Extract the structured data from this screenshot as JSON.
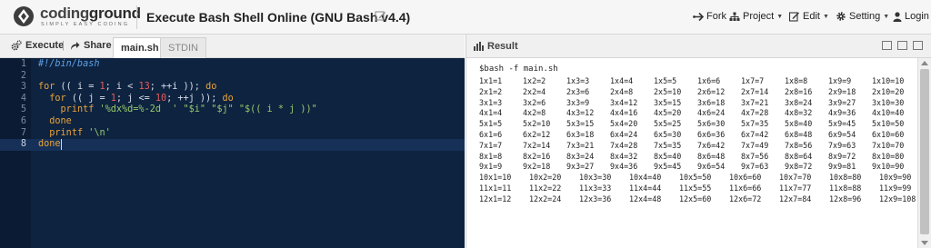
{
  "header": {
    "logo_text_a": "coding",
    "logo_text_b": "ground",
    "logo_tagline": "SIMPLY EASY CODING",
    "title": "Execute Bash Shell Online (GNU Bash v4.4)",
    "menu": {
      "fork": "Fork",
      "project": "Project",
      "edit": "Edit",
      "setting": "Setting",
      "login": "Login"
    }
  },
  "toolbar": {
    "execute": "Execute",
    "separator": "|",
    "share": "Share",
    "tabs": [
      "main.sh",
      "STDIN"
    ]
  },
  "editor": {
    "lines": [
      "#!/bin/bash",
      "",
      "for (( i = 1; i < 13; ++i )); do",
      "  for (( j = 1; j <= 10; ++j )); do",
      "    printf '%dx%d=%-2d  ' \"$i\" \"$j\" \"$(( i * j ))\"",
      "  done",
      "  printf '\\n'",
      "done"
    ],
    "active_line": 8
  },
  "result": {
    "label": "Result",
    "command": "$bash -f main.sh",
    "rows": [
      [
        "1x1=1",
        "1x2=2",
        "1x3=3",
        "1x4=4",
        "1x5=5",
        "1x6=6",
        "1x7=7",
        "1x8=8",
        "1x9=9",
        "1x10=10"
      ],
      [
        "2x1=2",
        "2x2=4",
        "2x3=6",
        "2x4=8",
        "2x5=10",
        "2x6=12",
        "2x7=14",
        "2x8=16",
        "2x9=18",
        "2x10=20"
      ],
      [
        "3x1=3",
        "3x2=6",
        "3x3=9",
        "3x4=12",
        "3x5=15",
        "3x6=18",
        "3x7=21",
        "3x8=24",
        "3x9=27",
        "3x10=30"
      ],
      [
        "4x1=4",
        "4x2=8",
        "4x3=12",
        "4x4=16",
        "4x5=20",
        "4x6=24",
        "4x7=28",
        "4x8=32",
        "4x9=36",
        "4x10=40"
      ],
      [
        "5x1=5",
        "5x2=10",
        "5x3=15",
        "5x4=20",
        "5x5=25",
        "5x6=30",
        "5x7=35",
        "5x8=40",
        "5x9=45",
        "5x10=50"
      ],
      [
        "6x1=6",
        "6x2=12",
        "6x3=18",
        "6x4=24",
        "6x5=30",
        "6x6=36",
        "6x7=42",
        "6x8=48",
        "6x9=54",
        "6x10=60"
      ],
      [
        "7x1=7",
        "7x2=14",
        "7x3=21",
        "7x4=28",
        "7x5=35",
        "7x6=42",
        "7x7=49",
        "7x8=56",
        "7x9=63",
        "7x10=70"
      ],
      [
        "8x1=8",
        "8x2=16",
        "8x3=24",
        "8x4=32",
        "8x5=40",
        "8x6=48",
        "8x7=56",
        "8x8=64",
        "8x9=72",
        "8x10=80"
      ],
      [
        "9x1=9",
        "9x2=18",
        "9x3=27",
        "9x4=36",
        "9x5=45",
        "9x6=54",
        "9x7=63",
        "9x8=72",
        "9x9=81",
        "9x10=90"
      ],
      [
        "10x1=10",
        "10x2=20",
        "10x3=30",
        "10x4=40",
        "10x5=50",
        "10x6=60",
        "10x7=70",
        "10x8=80",
        "10x9=90"
      ],
      [
        "11x1=11",
        "11x2=22",
        "11x3=33",
        "11x4=44",
        "11x5=55",
        "11x6=66",
        "11x7=77",
        "11x8=88",
        "11x9=99"
      ],
      [
        "12x1=12",
        "12x2=24",
        "12x3=36",
        "12x4=48",
        "12x5=60",
        "12x6=72",
        "12x7=84",
        "12x8=96",
        "12x9=108"
      ]
    ]
  },
  "colors": {
    "editor_bg": "#0e2340",
    "keyword": "#e8a33a",
    "comment": "#5fa3e8",
    "number": "#e35c5c",
    "string": "#98c96b"
  },
  "icons": [
    "logo-icon",
    "edit-icon",
    "fork-icon",
    "project-icon",
    "edit-menu-icon",
    "gear-icon",
    "login-icon",
    "execute-gear-icon",
    "share-icon",
    "result-chart-icon"
  ]
}
